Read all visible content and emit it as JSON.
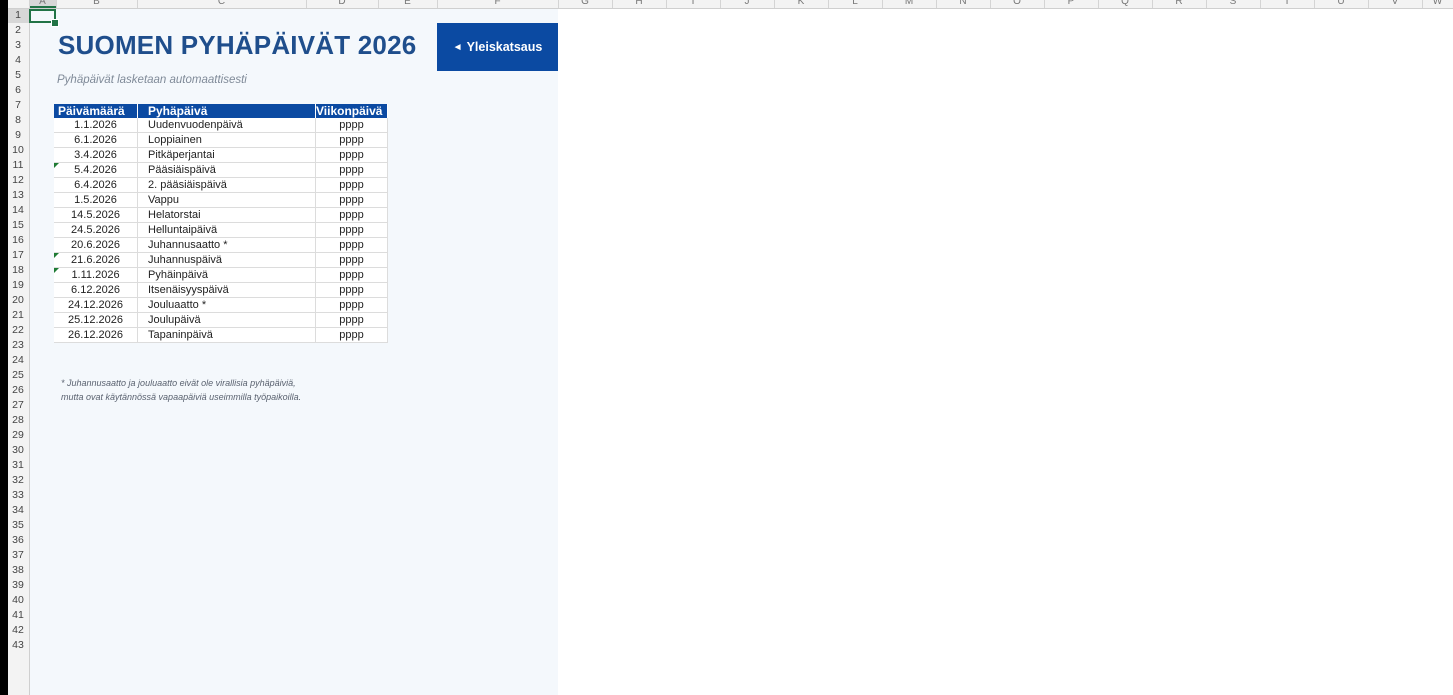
{
  "spreadsheet": {
    "columns": [
      "A",
      "B",
      "C",
      "D",
      "E",
      "F",
      "G",
      "H",
      "I",
      "J",
      "K",
      "L",
      "M",
      "N",
      "O",
      "P",
      "Q",
      "R",
      "S",
      "T",
      "U",
      "V",
      "W"
    ],
    "rows": [
      "1",
      "2",
      "3",
      "4",
      "5",
      "6",
      "7",
      "8",
      "9",
      "10",
      "11",
      "12",
      "13",
      "14",
      "15",
      "16",
      "17",
      "18",
      "19",
      "20",
      "21",
      "22",
      "23",
      "24",
      "25",
      "26",
      "27",
      "28",
      "29",
      "30",
      "31",
      "32",
      "33",
      "34",
      "35",
      "36",
      "37",
      "38",
      "39",
      "40",
      "41",
      "42",
      "43"
    ]
  },
  "header": {
    "title": "SUOMEN PYHÄPÄIVÄT 2026",
    "subtitle": "Pyhäpäivät lasketaan automaattisesti",
    "nav_button": {
      "arrow": "◄",
      "label": "Yleiskatsaus"
    }
  },
  "table": {
    "columns": [
      "Päivämäärä",
      "Pyhäpäivä",
      "Viikonpäivä"
    ],
    "rows": [
      {
        "date": "1.1.2026",
        "holiday": "Uudenvuodenpäivä",
        "weekday": "pppp",
        "flag": false
      },
      {
        "date": "6.1.2026",
        "holiday": "Loppiainen",
        "weekday": "pppp",
        "flag": false
      },
      {
        "date": "3.4.2026",
        "holiday": "Pitkäperjantai",
        "weekday": "pppp",
        "flag": false
      },
      {
        "date": "5.4.2026",
        "holiday": "Pääsiäispäivä",
        "weekday": "pppp",
        "flag": true
      },
      {
        "date": "6.4.2026",
        "holiday": "2. pääsiäispäivä",
        "weekday": "pppp",
        "flag": false
      },
      {
        "date": "1.5.2026",
        "holiday": "Vappu",
        "weekday": "pppp",
        "flag": false
      },
      {
        "date": "14.5.2026",
        "holiday": "Helatorstai",
        "weekday": "pppp",
        "flag": false
      },
      {
        "date": "24.5.2026",
        "holiday": "Helluntaipäivä",
        "weekday": "pppp",
        "flag": false
      },
      {
        "date": "20.6.2026",
        "holiday": "Juhannusaatto *",
        "weekday": "pppp",
        "flag": false
      },
      {
        "date": "21.6.2026",
        "holiday": "Juhannuspäivä",
        "weekday": "pppp",
        "flag": true
      },
      {
        "date": "1.11.2026",
        "holiday": "Pyhäinpäivä",
        "weekday": "pppp",
        "flag": true
      },
      {
        "date": "6.12.2026",
        "holiday": "Itsenäisyyspäivä",
        "weekday": "pppp",
        "flag": false
      },
      {
        "date": "24.12.2026",
        "holiday": "Jouluaatto *",
        "weekday": "pppp",
        "flag": false
      },
      {
        "date": "25.12.2026",
        "holiday": "Joulupäivä",
        "weekday": "pppp",
        "flag": false
      },
      {
        "date": "26.12.2026",
        "holiday": "Tapaninpäivä",
        "weekday": "pppp",
        "flag": false
      }
    ]
  },
  "footnote": {
    "line1": "* Juhannusaatto ja jouluaatto eivät ole virallisia pyhäpäiviä,",
    "line2": "mutta ovat käytännössä vapaapäiviä useimmilla työpaikoilla."
  },
  "colors": {
    "accent": "#0b4aa2",
    "title": "#1f4e8c",
    "sheet_bg": "#f4f8fc",
    "selection": "#217346"
  }
}
